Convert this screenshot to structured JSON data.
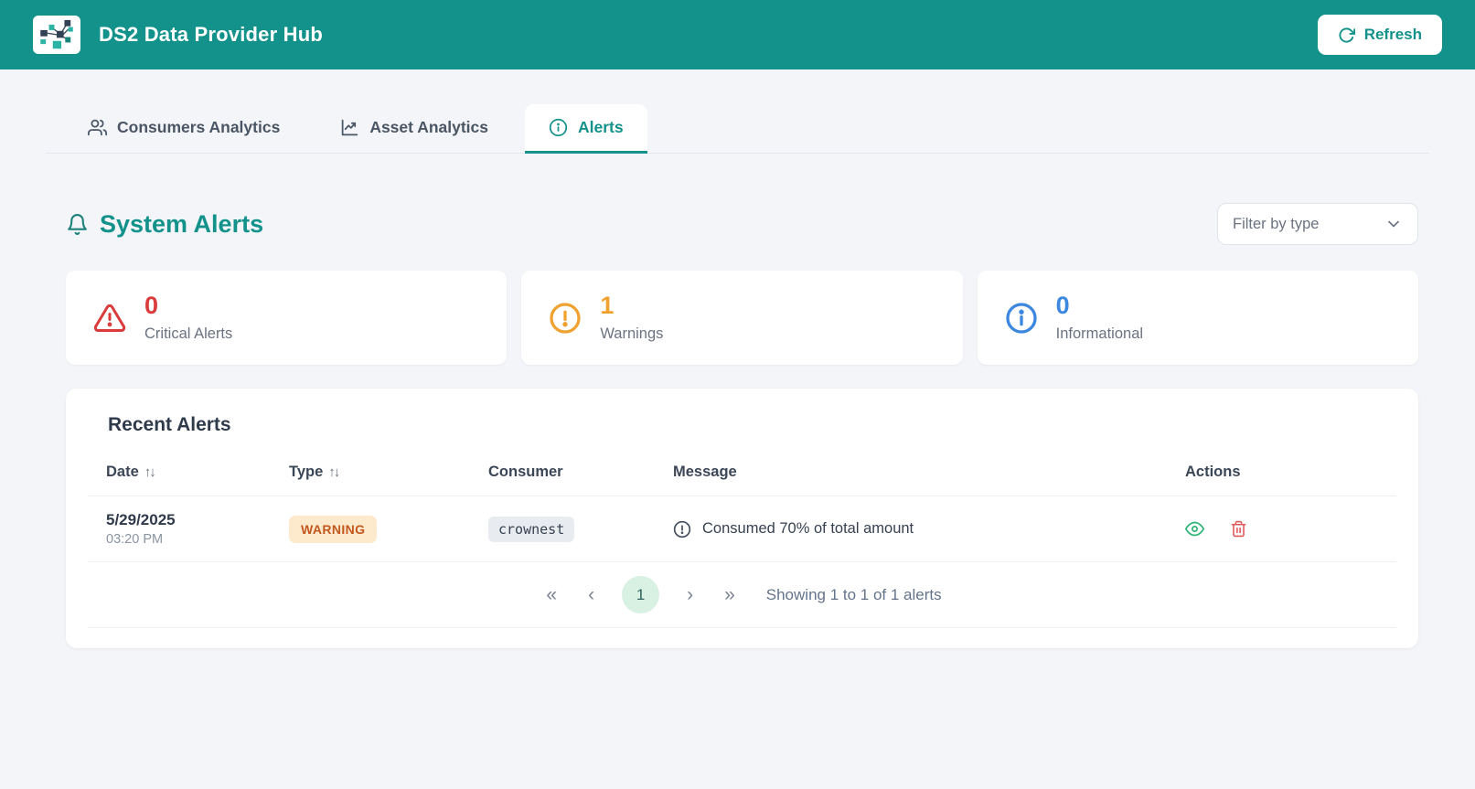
{
  "header": {
    "title": "DS2 Data Provider Hub",
    "refresh_label": "Refresh"
  },
  "tabs": [
    {
      "label": "Consumers Analytics",
      "active": false
    },
    {
      "label": "Asset Analytics",
      "active": false
    },
    {
      "label": "Alerts",
      "active": true
    }
  ],
  "alerts_section": {
    "title": "System Alerts",
    "filter_placeholder": "Filter by type",
    "summary_cards": [
      {
        "count": "0",
        "label": "Critical Alerts",
        "color": "#da3b3b",
        "icon": "warning-triangle-icon"
      },
      {
        "count": "1",
        "label": "Warnings",
        "color": "#f0a12f",
        "icon": "alert-circle-icon"
      },
      {
        "count": "0",
        "label": "Informational",
        "color": "#3c87e0",
        "icon": "info-circle-icon"
      }
    ]
  },
  "recent_alerts": {
    "title": "Recent Alerts",
    "columns": [
      "Date",
      "Type",
      "Consumer",
      "Message",
      "Actions"
    ],
    "sort_icon": "↑↓",
    "rows": [
      {
        "date": "5/29/2025",
        "time": "03:20 PM",
        "type": "WARNING",
        "consumer": "crownest",
        "message": "Consumed 70% of total amount"
      }
    ],
    "pagination": {
      "first": "«",
      "prev": "‹",
      "page": "1",
      "next": "›",
      "last": "»",
      "summary": "Showing 1 to 1 of 1 alerts"
    }
  },
  "colors": {
    "brand_teal": "#13928b",
    "page_background": "#f3f5f9",
    "critical": "#da3b3b",
    "warning": "#f0a12f",
    "informational": "#3c87e0",
    "warning_badge_bg": "#fdeacd",
    "warning_badge_text": "#c2571f",
    "pager_current_bg": "#d9f1e3"
  }
}
